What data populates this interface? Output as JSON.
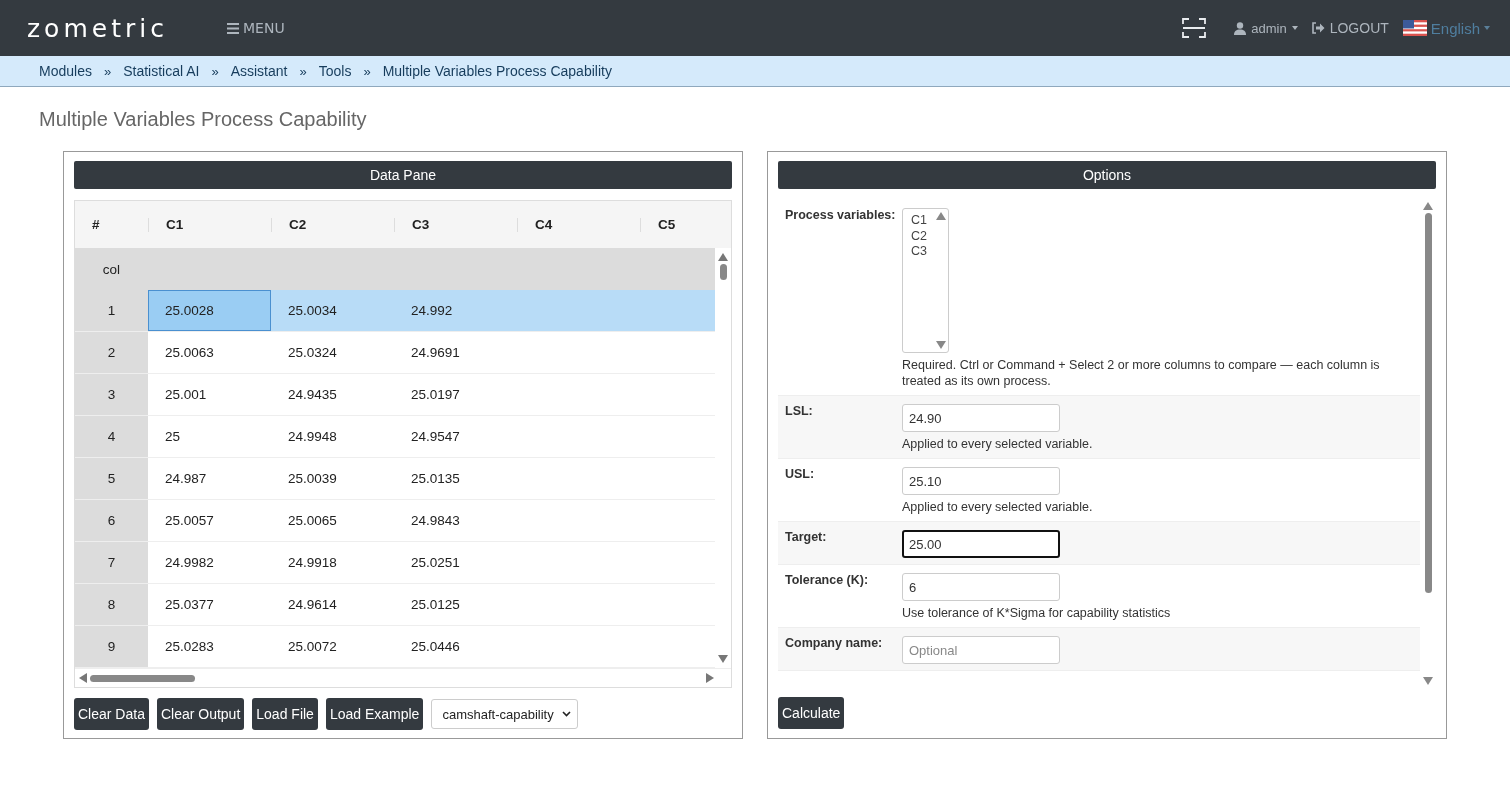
{
  "header": {
    "logo": "zometric",
    "menu": "MENU",
    "user": "admin",
    "logout": "LOGOUT",
    "language": "English"
  },
  "breadcrumbs": {
    "separator": "»",
    "items": [
      "Modules",
      "Statistical AI",
      "Assistant",
      "Tools",
      "Multiple Variables Process Capability"
    ]
  },
  "page_title": "Multiple Variables Process Capability",
  "data_pane": {
    "title": "Data Pane",
    "index_header": "#",
    "columns": [
      "C1",
      "C2",
      "C3",
      "C4",
      "C5"
    ],
    "label_row": "col",
    "rows": [
      {
        "index": "1",
        "selected": true,
        "cells": [
          {
            "value": "25.0028",
            "focused": true
          },
          {
            "value": "25.0034",
            "focused": false
          },
          {
            "value": "24.992",
            "focused": false
          }
        ]
      },
      {
        "index": "2",
        "selected": false,
        "cells": [
          {
            "value": "25.0063",
            "focused": false
          },
          {
            "value": "25.0324",
            "focused": false
          },
          {
            "value": "24.9691",
            "focused": false
          }
        ]
      },
      {
        "index": "3",
        "selected": false,
        "cells": [
          {
            "value": "25.001",
            "focused": false
          },
          {
            "value": "24.9435",
            "focused": false
          },
          {
            "value": "25.0197",
            "focused": false
          }
        ]
      },
      {
        "index": "4",
        "selected": false,
        "cells": [
          {
            "value": "25",
            "focused": false
          },
          {
            "value": "24.9948",
            "focused": false
          },
          {
            "value": "24.9547",
            "focused": false
          }
        ]
      },
      {
        "index": "5",
        "selected": false,
        "cells": [
          {
            "value": "24.987",
            "focused": false
          },
          {
            "value": "25.0039",
            "focused": false
          },
          {
            "value": "25.0135",
            "focused": false
          }
        ]
      },
      {
        "index": "6",
        "selected": false,
        "cells": [
          {
            "value": "25.0057",
            "focused": false
          },
          {
            "value": "25.0065",
            "focused": false
          },
          {
            "value": "24.9843",
            "focused": false
          }
        ]
      },
      {
        "index": "7",
        "selected": false,
        "cells": [
          {
            "value": "24.9982",
            "focused": false
          },
          {
            "value": "24.9918",
            "focused": false
          },
          {
            "value": "25.0251",
            "focused": false
          }
        ]
      },
      {
        "index": "8",
        "selected": false,
        "cells": [
          {
            "value": "25.0377",
            "focused": false
          },
          {
            "value": "24.9614",
            "focused": false
          },
          {
            "value": "25.0125",
            "focused": false
          }
        ]
      },
      {
        "index": "9",
        "selected": false,
        "cells": [
          {
            "value": "25.0283",
            "focused": false
          },
          {
            "value": "25.0072",
            "focused": false
          },
          {
            "value": "25.0446",
            "focused": false
          }
        ]
      }
    ],
    "buttons": [
      "Clear Data",
      "Clear Output",
      "Load File",
      "Load Example"
    ],
    "example_select": "camshaft-capability"
  },
  "options": {
    "title": "Options",
    "fields": [
      {
        "kind": "listbox",
        "label": "Process variables:",
        "options": [
          "C1",
          "C2",
          "C3"
        ],
        "help": "Required. Ctrl or Command + Select 2 or more columns to compare — each column is treated as its own process."
      },
      {
        "kind": "input",
        "label": "LSL:",
        "value": "24.90",
        "focused": false,
        "help": "Applied to every selected variable."
      },
      {
        "kind": "input",
        "label": "USL:",
        "value": "25.10",
        "focused": false,
        "help": "Applied to every selected variable."
      },
      {
        "kind": "input",
        "label": "Target:",
        "value": "25.00",
        "focused": true
      },
      {
        "kind": "input",
        "label": "Tolerance (K):",
        "value": "6",
        "focused": false,
        "help": "Use tolerance of K*Sigma for capability statistics"
      },
      {
        "kind": "input",
        "label": "Company name:",
        "placeholder": "Optional",
        "focused": false
      }
    ],
    "button": "Calculate"
  }
}
